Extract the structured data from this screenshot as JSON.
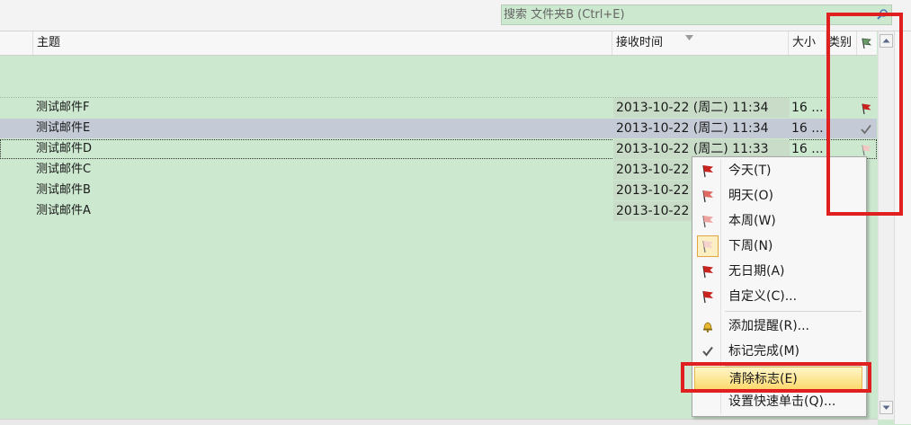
{
  "search": {
    "placeholder": "搜索 文件夹B (Ctrl+E)"
  },
  "columns": {
    "subject": "主题",
    "received": "接收时间",
    "size": "大小",
    "category": "类别"
  },
  "emails": [
    {
      "subject": "测试邮件F",
      "time": "2013-10-22 (周二) 11:34",
      "size": "16 ...",
      "flag": "red-flag"
    },
    {
      "subject": "测试邮件E",
      "time": "2013-10-22 (周二) 11:34",
      "size": "16 ...",
      "flag": "checkmark"
    },
    {
      "subject": "测试邮件D",
      "time": "2013-10-22 (周二) 11:33",
      "size": "16 ...",
      "flag": "pale-flag"
    },
    {
      "subject": "测试邮件C",
      "time": "2013-10-22",
      "size": "",
      "flag": ""
    },
    {
      "subject": "测试邮件B",
      "time": "2013-10-22",
      "size": "",
      "flag": ""
    },
    {
      "subject": "测试邮件A",
      "time": "2013-10-22",
      "size": "",
      "flag": ""
    }
  ],
  "menu": [
    {
      "label": "今天(T)",
      "icon": "flag-today-icon"
    },
    {
      "label": "明天(O)",
      "icon": "flag-tomorrow-icon"
    },
    {
      "label": "本周(W)",
      "icon": "flag-this-week-icon"
    },
    {
      "label": "下周(N)",
      "icon": "flag-next-week-icon"
    },
    {
      "label": "无日期(A)",
      "icon": "flag-no-date-icon"
    },
    {
      "label": "自定义(C)...",
      "icon": "flag-custom-icon"
    },
    {
      "label": "添加提醒(R)...",
      "icon": "bell-icon"
    },
    {
      "label": "标记完成(M)",
      "icon": "checkmark-icon"
    },
    {
      "label": "清除标志(E)",
      "icon": ""
    },
    {
      "label": "设置快速单击(Q)...",
      "icon": ""
    }
  ],
  "colors": {
    "background": "#cce8cf",
    "selected_row": "#c5cbd6",
    "flag_red": "#c8231e",
    "annotation_red": "#e02020",
    "menu_highlight": "#fbd96d"
  }
}
